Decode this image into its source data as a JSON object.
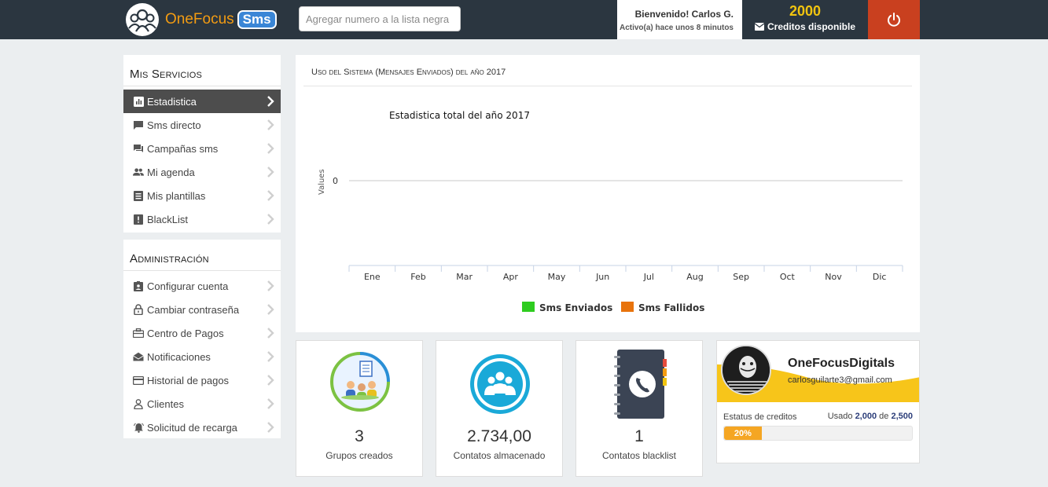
{
  "header": {
    "brand": "OneFocus",
    "brand_badge": "Sms",
    "search_placeholder": "Agregar numero a la lista negra",
    "welcome": "Bienvenido! Carlos G.",
    "activity": "Activo(a) hace unos 8 minutos",
    "credits_value": "2000",
    "credits_label": "Creditos disponible",
    "accent": "#f39c12",
    "power_color": "#c9401f"
  },
  "sidebar": {
    "services_title": "Mis Servicios",
    "services": [
      {
        "label": "Estadistica",
        "icon": "bar-chart-icon",
        "active": true
      },
      {
        "label": "Sms directo",
        "icon": "message-icon"
      },
      {
        "label": "Campañas sms",
        "icon": "chat-icon"
      },
      {
        "label": "Mi agenda",
        "icon": "people-icon"
      },
      {
        "label": "Mis plantillas",
        "icon": "list-icon"
      },
      {
        "label": "BlackList",
        "icon": "alert-icon"
      }
    ],
    "admin_title": "Administración",
    "admin": [
      {
        "label": "Configurar cuenta",
        "icon": "id-card-icon"
      },
      {
        "label": "Cambiar contraseña",
        "icon": "lock-icon"
      },
      {
        "label": "Centro de Pagos",
        "icon": "briefcase-icon"
      },
      {
        "label": "Notificaciones",
        "icon": "envelope-open-icon"
      },
      {
        "label": "Historial de pagos",
        "icon": "credit-card-icon"
      },
      {
        "label": "Clientes",
        "icon": "user-icon"
      },
      {
        "label": "Solicitud de recarga",
        "icon": "bell-icon"
      }
    ]
  },
  "chart_panel": {
    "heading": "Uso del Sistema (Mensajes Enviados) del año 2017"
  },
  "chart_data": {
    "type": "bar",
    "title": "Estadistica total del año 2017",
    "ylabel": "Values",
    "xlabel": "",
    "yticks": [
      "0"
    ],
    "categories": [
      "Ene",
      "Feb",
      "Mar",
      "Apr",
      "May",
      "Jun",
      "Jul",
      "Aug",
      "Sep",
      "Oct",
      "Nov",
      "Dic"
    ],
    "series": [
      {
        "name": "Sms Enviados",
        "color": "#2ecc1f",
        "values": [
          0,
          0,
          0,
          0,
          0,
          0,
          0,
          0,
          0,
          0,
          0,
          0
        ]
      },
      {
        "name": "Sms Fallidos",
        "color": "#e8730c",
        "values": [
          0,
          0,
          0,
          0,
          0,
          0,
          0,
          0,
          0,
          0,
          0,
          0
        ]
      }
    ],
    "legend": "bottom",
    "grid": true
  },
  "stats": [
    {
      "value": "3",
      "label": "Grupos creados",
      "icon": "groups-icon"
    },
    {
      "value": "2.734,00",
      "label": "Contatos almacenado",
      "icon": "contacts-icon"
    },
    {
      "value": "1",
      "label": "Contatos blacklist",
      "icon": "phonebook-icon"
    }
  ],
  "profile": {
    "name": "OneFocusDigitals",
    "email": "carlosguilarte3@gmail.com",
    "status_label": "Estatus de creditos",
    "usage_prefix": "Usado",
    "used": "2,000",
    "usage_of": "de",
    "total": "2,500",
    "progress_label": "20%",
    "progress": 0.2,
    "banner_color": "#f7c51a"
  }
}
